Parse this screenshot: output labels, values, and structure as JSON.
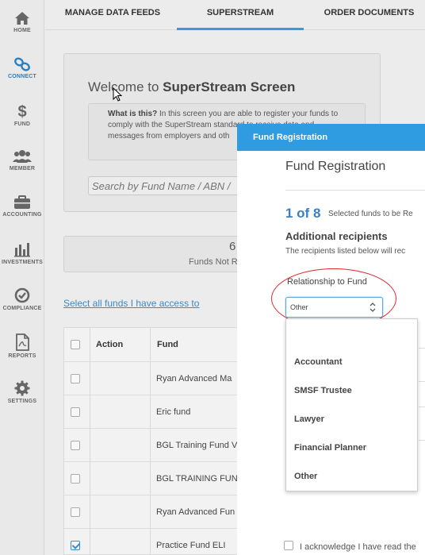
{
  "sidebar": {
    "items": [
      {
        "label": "HOME",
        "icon": "home-icon",
        "active": false
      },
      {
        "label": "CONNECT",
        "icon": "link-icon",
        "active": true
      },
      {
        "label": "FUND",
        "icon": "dollar-icon",
        "active": false
      },
      {
        "label": "MEMBER",
        "icon": "users-icon",
        "active": false
      },
      {
        "label": "ACCOUNTING",
        "icon": "briefcase-icon",
        "active": false
      },
      {
        "label": "INVESTMENTS",
        "icon": "bar-chart-icon",
        "active": false
      },
      {
        "label": "COMPLIANCE",
        "icon": "check-circle-icon",
        "active": false
      },
      {
        "label": "REPORTS",
        "icon": "pdf-document-icon",
        "active": false
      },
      {
        "label": "SETTINGS",
        "icon": "gear-icon",
        "active": false
      }
    ]
  },
  "tabs": [
    {
      "label": "MANAGE DATA FEEDS",
      "active": false
    },
    {
      "label": "SUPERSTREAM",
      "active": true
    },
    {
      "label": "ORDER DOCUMENTS",
      "active": false
    }
  ],
  "welcome": {
    "title_prefix": "Welcome to ",
    "title_bold": "SuperStream Screen",
    "info_bold": "What is this?",
    "info_text": " In this screen you are able to register your funds to comply with the SuperStream standard to receive data and messages from employers and oth",
    "search_placeholder": "Search by Fund Name / ABN /"
  },
  "stats": {
    "value": "6",
    "label": "Funds Not R"
  },
  "select_all_link": "Select all funds I have access to",
  "table": {
    "headers": {
      "action": "Action",
      "fund": "Fund"
    },
    "rows": [
      {
        "fund": "Ryan Advanced Ma",
        "checked": false
      },
      {
        "fund": "Eric fund",
        "checked": false
      },
      {
        "fund": "BGL Training Fund V",
        "checked": false
      },
      {
        "fund": "BGL TRAINING FUN",
        "checked": false
      },
      {
        "fund": "Ryan Advanced Fun",
        "checked": false
      },
      {
        "fund": "Practice Fund ELI",
        "checked": true
      }
    ]
  },
  "modal": {
    "header": "Fund Registration",
    "title": "Fund Registration",
    "counter": "1 of 8",
    "counter_text": "Selected funds to be Re",
    "section_title": "Additional recipients",
    "section_desc": "The recipients listed below will rec",
    "relationship_label": "Relationship to Fund",
    "relationship_value": "Other",
    "options": [
      "Accountant",
      "SMSF Trustee",
      "Lawyer",
      "Financial Planner",
      "Other"
    ],
    "acknowledge": "I acknowledge I have read the"
  },
  "colors": {
    "accent": "#2f9be0",
    "highlight": "#e0282e",
    "link": "#3a8ac9"
  }
}
